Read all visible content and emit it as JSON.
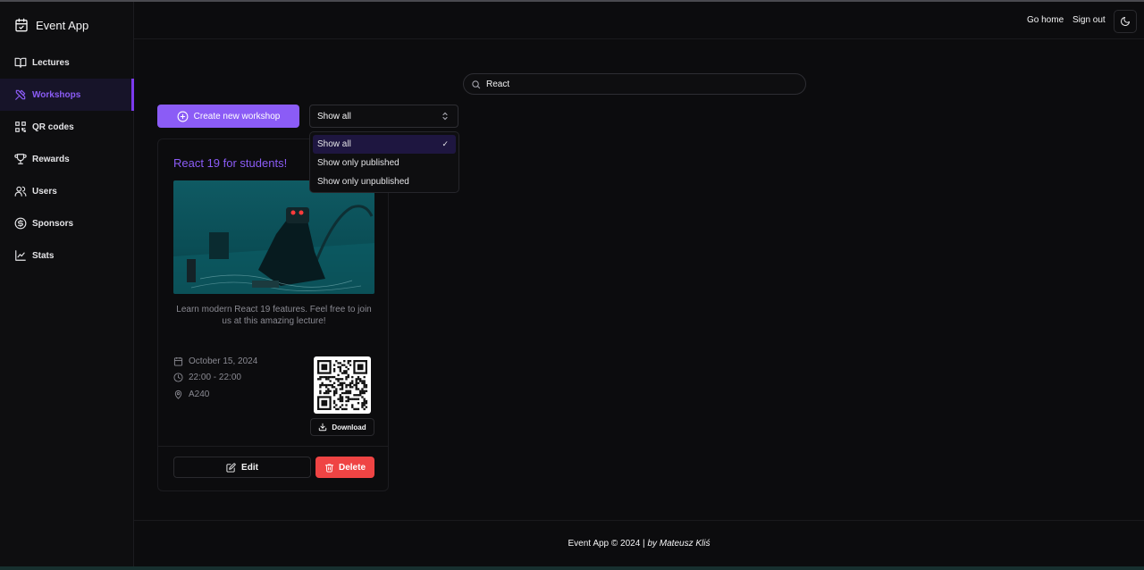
{
  "app": {
    "title": "Event App"
  },
  "sidebar": {
    "items": [
      {
        "label": "Lectures",
        "icon": "book-icon"
      },
      {
        "label": "Workshops",
        "icon": "tools-icon",
        "active": true
      },
      {
        "label": "QR codes",
        "icon": "qr-code-icon"
      },
      {
        "label": "Rewards",
        "icon": "trophy-icon"
      },
      {
        "label": "Users",
        "icon": "users-icon"
      },
      {
        "label": "Sponsors",
        "icon": "dollar-icon"
      },
      {
        "label": "Stats",
        "icon": "chart-line-icon"
      }
    ]
  },
  "header": {
    "go_home": "Go home",
    "sign_out": "Sign out",
    "theme_icon": "moon-icon"
  },
  "search": {
    "value": "React",
    "icon": "search-icon"
  },
  "toolbar": {
    "create_label": "Create new workshop",
    "filter_value": "Show all",
    "filter_options": [
      "Show all",
      "Show only published",
      "Show only unpublished"
    ],
    "selected_check": "✓"
  },
  "card": {
    "title": "React 19 for students!",
    "description": "Learn modern React 19 features. Feel free to join us at this amazing lecture!",
    "date": "October 15, 2024",
    "time": "22:00 - 22:00",
    "room": "A240",
    "download_label": "Download",
    "edit_label": "Edit",
    "delete_label": "Delete"
  },
  "footer": {
    "text": "Event App © 2024 | ",
    "author": "by Mateusz Kliś"
  },
  "colors": {
    "accent": "#8b5cf6",
    "danger": "#ef4444",
    "background": "#0c0c0e"
  }
}
